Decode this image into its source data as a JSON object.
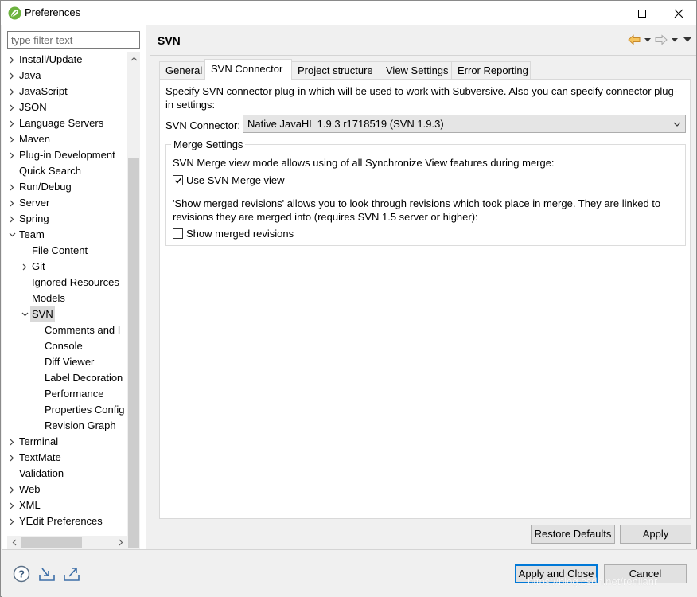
{
  "window": {
    "title": "Preferences",
    "icon": "eclipse-spring-leaf-icon",
    "controls": [
      "minimize-icon",
      "maximize-icon",
      "close-icon"
    ]
  },
  "filter": {
    "placeholder": "type filter text",
    "value": ""
  },
  "tree": [
    {
      "label": "Install/Update",
      "level": 0,
      "arrow": "collapsed"
    },
    {
      "label": "Java",
      "level": 0,
      "arrow": "collapsed"
    },
    {
      "label": "JavaScript",
      "level": 0,
      "arrow": "collapsed"
    },
    {
      "label": "JSON",
      "level": 0,
      "arrow": "collapsed"
    },
    {
      "label": "Language Servers",
      "level": 0,
      "arrow": "collapsed"
    },
    {
      "label": "Maven",
      "level": 0,
      "arrow": "collapsed"
    },
    {
      "label": "Plug-in Development",
      "level": 0,
      "arrow": "collapsed"
    },
    {
      "label": "Quick Search",
      "level": 0,
      "arrow": "none"
    },
    {
      "label": "Run/Debug",
      "level": 0,
      "arrow": "collapsed"
    },
    {
      "label": "Server",
      "level": 0,
      "arrow": "collapsed"
    },
    {
      "label": "Spring",
      "level": 0,
      "arrow": "collapsed"
    },
    {
      "label": "Team",
      "level": 0,
      "arrow": "expanded"
    },
    {
      "label": "File Content",
      "level": 1,
      "arrow": "none"
    },
    {
      "label": "Git",
      "level": 1,
      "arrow": "collapsed"
    },
    {
      "label": "Ignored Resources",
      "level": 1,
      "arrow": "none"
    },
    {
      "label": "Models",
      "level": 1,
      "arrow": "none"
    },
    {
      "label": "SVN",
      "level": 1,
      "arrow": "expanded",
      "selected": true
    },
    {
      "label": "Comments and I",
      "level": 2,
      "arrow": "none"
    },
    {
      "label": "Console",
      "level": 2,
      "arrow": "none"
    },
    {
      "label": "Diff Viewer",
      "level": 2,
      "arrow": "none"
    },
    {
      "label": "Label Decoration",
      "level": 2,
      "arrow": "none"
    },
    {
      "label": "Performance",
      "level": 2,
      "arrow": "none"
    },
    {
      "label": "Properties Config",
      "level": 2,
      "arrow": "none"
    },
    {
      "label": "Revision Graph",
      "level": 2,
      "arrow": "none"
    },
    {
      "label": "Terminal",
      "level": 0,
      "arrow": "collapsed"
    },
    {
      "label": "TextMate",
      "level": 0,
      "arrow": "collapsed"
    },
    {
      "label": "Validation",
      "level": 0,
      "arrow": "none"
    },
    {
      "label": "Web",
      "level": 0,
      "arrow": "collapsed"
    },
    {
      "label": "XML",
      "level": 0,
      "arrow": "collapsed"
    },
    {
      "label": "YEdit Preferences",
      "level": 0,
      "arrow": "collapsed"
    }
  ],
  "page": {
    "title": "SVN",
    "nav_icons": [
      "back-arrow-icon",
      "back-menu-icon",
      "forward-arrow-icon",
      "forward-menu-icon",
      "view-menu-icon"
    ]
  },
  "tabs": [
    {
      "label": "General",
      "active": false
    },
    {
      "label": "SVN Connector",
      "active": true
    },
    {
      "label": "Project structure",
      "active": false
    },
    {
      "label": "View Settings",
      "active": false
    },
    {
      "label": "Error Reporting",
      "active": false
    }
  ],
  "connector": {
    "description": "Specify SVN connector plug-in which will be used to work with Subversive. Also you can specify connector plug-in settings:",
    "label": "SVN Connector:",
    "selected": "Native JavaHL 1.9.3 r1718519 (SVN 1.9.3)"
  },
  "merge": {
    "group_title": "Merge Settings",
    "text1": "SVN Merge view mode allows using of all Synchronize View features during merge:",
    "use_merge_view_label": "Use SVN Merge view",
    "use_merge_view_checked": true,
    "text2": "'Show merged revisions' allows you to look through revisions which took place in merge. They are linked to revisions they are merged into (requires SVN 1.5 server or higher):",
    "show_merged_label": "Show merged revisions",
    "show_merged_checked": false
  },
  "buttons": {
    "restore_defaults": "Restore Defaults",
    "apply": "Apply",
    "apply_and_close": "Apply and Close",
    "cancel": "Cancel"
  },
  "bottom_icons": [
    "help-icon",
    "import-icon",
    "export-icon"
  ],
  "watermark": "https://blog.csdn.net/renlianr",
  "colors": {
    "accent": "#0078d7",
    "selection": "#d9d9d9",
    "nav_arrow": "#e8a33b"
  }
}
